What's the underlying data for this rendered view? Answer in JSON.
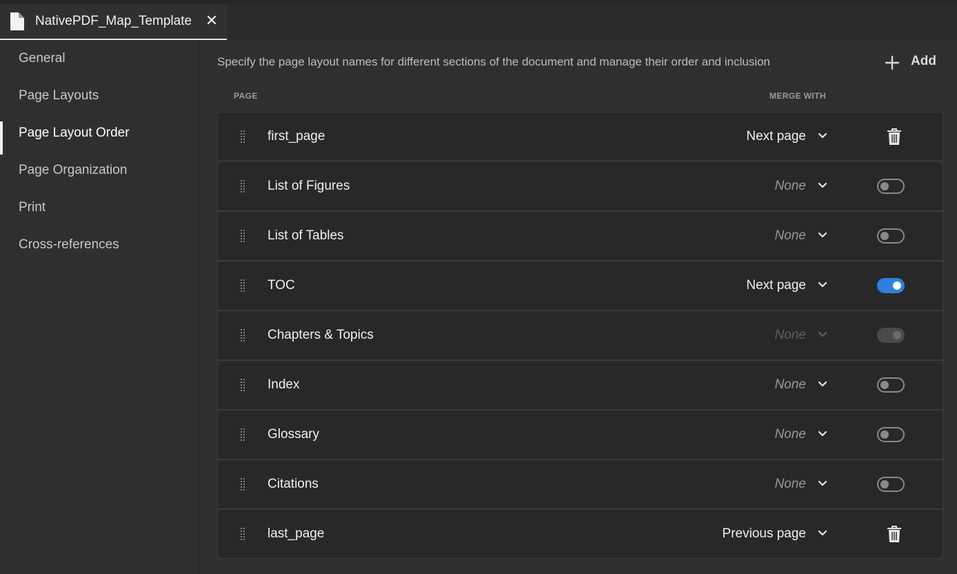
{
  "tab": {
    "title": "NativePDF_Map_Template",
    "file_icon": "file-icon",
    "close_icon": "close-icon"
  },
  "sidebar": {
    "items": [
      {
        "label": "General"
      },
      {
        "label": "Page Layouts"
      },
      {
        "label": "Page Layout Order",
        "active": true
      },
      {
        "label": "Page Organization"
      },
      {
        "label": "Print"
      },
      {
        "label": "Cross-references"
      }
    ]
  },
  "main": {
    "description": "Specify the page layout names for different sections of the document and manage their order and inclusion",
    "add_label": "Add",
    "columns": {
      "page": "PAGE",
      "merge_with": "MERGE WITH"
    },
    "rows": [
      {
        "name": "first_page",
        "merge": "Next page",
        "control": "trash"
      },
      {
        "name": "List of Figures",
        "merge": "None",
        "control": "toggle",
        "enabled": false
      },
      {
        "name": "List of Tables",
        "merge": "None",
        "control": "toggle",
        "enabled": false
      },
      {
        "name": "TOC",
        "merge": "Next page",
        "control": "toggle",
        "enabled": true
      },
      {
        "name": "Chapters & Topics",
        "merge": "None",
        "control": "toggle",
        "enabled": true,
        "locked": true
      },
      {
        "name": "Index",
        "merge": "None",
        "control": "toggle",
        "enabled": false
      },
      {
        "name": "Glossary",
        "merge": "None",
        "control": "toggle",
        "enabled": false
      },
      {
        "name": "Citations",
        "merge": "None",
        "control": "toggle",
        "enabled": false
      },
      {
        "name": "last_page",
        "merge": "Previous page",
        "control": "trash"
      }
    ]
  },
  "colors": {
    "accent": "#2f7fde",
    "background": "#2f2f2f",
    "row_background": "#282828"
  }
}
